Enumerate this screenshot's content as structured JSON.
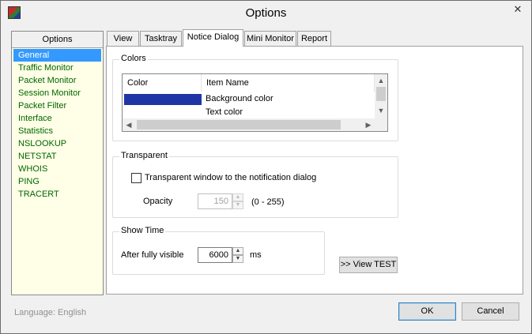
{
  "window": {
    "title": "Options",
    "close_glyph": "✕"
  },
  "options": {
    "header": "Options",
    "items": [
      "General",
      "Traffic Monitor",
      "Packet Monitor",
      "Session Monitor",
      "Packet Filter",
      "Interface",
      "Statistics",
      "NSLOOKUP",
      "NETSTAT",
      "WHOIS",
      "PING",
      "TRACERT"
    ],
    "selected": "General",
    "item_color": "#006600",
    "background": "#ffffe7"
  },
  "language": "Language: English",
  "tabs": [
    "View",
    "Tasktray",
    "Notice Dialog",
    "Mini Monitor",
    "Report"
  ],
  "active_tab": "Notice Dialog",
  "colors": {
    "label": "Colors",
    "columns": [
      "Color",
      "Item Name"
    ],
    "rows": [
      {
        "color": "#1f35a5",
        "name": "Background color"
      },
      {
        "color": "#ffffff",
        "name": "Text color"
      }
    ]
  },
  "transparent": {
    "label": "Transparent",
    "checkbox_label": "Transparent window to the notification dialog",
    "checked": false,
    "opacity_label": "Opacity",
    "opacity_value": "150",
    "opacity_range": "(0 - 255)"
  },
  "show_time": {
    "label": "Show Time",
    "field_label": "After fully visible",
    "value": "6000",
    "unit": "ms"
  },
  "buttons": {
    "view_test": ">> View TEST",
    "ok": "OK",
    "cancel": "Cancel"
  },
  "icons": {
    "scroll_up": "▲",
    "scroll_down": "▼",
    "scroll_left": "◀",
    "scroll_right": "▶",
    "spin_up": "▲",
    "spin_down": "▼"
  }
}
